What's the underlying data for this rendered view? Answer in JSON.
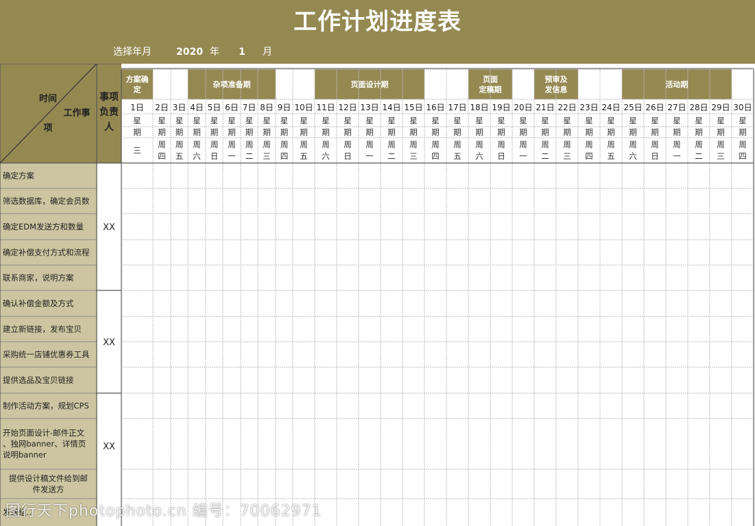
{
  "title": "工作计划进度表",
  "selector": {
    "label": "选择年月",
    "year": "2020",
    "year_unit": "年",
    "month": "1",
    "month_unit": "月"
  },
  "corner": {
    "time": "时间",
    "item": "工作事",
    "item2": "项"
  },
  "owner_header": [
    "事项",
    "负责",
    "人"
  ],
  "phases": [
    {
      "lines": [
        "方案确",
        "定"
      ],
      "start": 1,
      "end": 1
    },
    {
      "lines": [
        "杂项准备期"
      ],
      "start": 4,
      "end": 8
    },
    {
      "lines": [
        "页面设计期"
      ],
      "start": 11,
      "end": 15
    },
    {
      "lines": [
        "页面",
        "定稿期"
      ],
      "start": 18,
      "end": 19
    },
    {
      "lines": [
        "预审及",
        "发信息"
      ],
      "start": 21,
      "end": 22
    },
    {
      "lines": [
        "活动期"
      ],
      "start": 25,
      "end": 29
    }
  ],
  "days": [
    "1日",
    "2日",
    "3日",
    "4日",
    "5日",
    "6日",
    "7日",
    "8日",
    "9日",
    "10日",
    "11日",
    "12日",
    "13日",
    "14日",
    "15日",
    "16日",
    "17日",
    "18日",
    "19日",
    "20日",
    "21日",
    "22日",
    "23日",
    "24日",
    "25日",
    "26日",
    "27日",
    "28日",
    "29日",
    "30日"
  ],
  "week_label": [
    "星",
    "期"
  ],
  "weekdays": [
    [
      "三"
    ],
    [
      "周",
      "四"
    ],
    [
      "周",
      "五"
    ],
    [
      "周",
      "六"
    ],
    [
      "周",
      "日"
    ],
    [
      "周",
      "一"
    ],
    [
      "周",
      "二"
    ],
    [
      "周",
      "三"
    ],
    [
      "周",
      "四"
    ],
    [
      "周",
      "五"
    ],
    [
      "周",
      "六"
    ],
    [
      "周",
      "日"
    ],
    [
      "周",
      "一"
    ],
    [
      "周",
      "二"
    ],
    [
      "周",
      "三"
    ],
    [
      "周",
      "四"
    ],
    [
      "周",
      "五"
    ],
    [
      "周",
      "六"
    ],
    [
      "周",
      "日"
    ],
    [
      "周",
      "一"
    ],
    [
      "周",
      "二"
    ],
    [
      "周",
      "三"
    ],
    [
      "周",
      "四"
    ],
    [
      "周",
      "五"
    ],
    [
      "周",
      "六"
    ],
    [
      "周",
      "日"
    ],
    [
      "周",
      "一"
    ],
    [
      "周",
      "二"
    ],
    [
      "周",
      "三"
    ],
    [
      "周",
      "四"
    ]
  ],
  "tasks": [
    {
      "lines": [
        "确定方案"
      ]
    },
    {
      "lines": [
        "筛选数据库，确定会员数"
      ]
    },
    {
      "lines": [
        "确定EDM发送方和数量"
      ]
    },
    {
      "lines": [
        "确定补偿支付方式和流程"
      ]
    },
    {
      "lines": [
        "联系商家，说明方案"
      ]
    },
    {
      "lines": [
        "确认补偿金额及方式"
      ]
    },
    {
      "lines": [
        "建立新链接，发布宝贝"
      ]
    },
    {
      "lines": [
        "采购统一店铺优惠券工具"
      ]
    },
    {
      "lines": [
        "提供选品及宝贝链接"
      ]
    },
    {
      "lines": [
        "制作活动方案，规划CPS"
      ]
    },
    {
      "lines": [
        "开始页面设计-邮件正文",
        "、独网banner、详情页",
        "说明banner"
      ]
    },
    {
      "lines": [
        "提供设计稿文件给到邮",
        "件发送方"
      ],
      "center": true
    },
    {
      "lines": [
        "发送组…"
      ]
    }
  ],
  "owners": [
    "XX",
    "XX",
    "XX"
  ],
  "watermark": "图行天下photophoto.cn 编号：70062971",
  "colors": {
    "header_bg": "#958952",
    "phase_bg": "#958952",
    "task_bg": "#cdc5a1",
    "grid_line": "#bdbdbd",
    "text_white": "#ffffff"
  }
}
